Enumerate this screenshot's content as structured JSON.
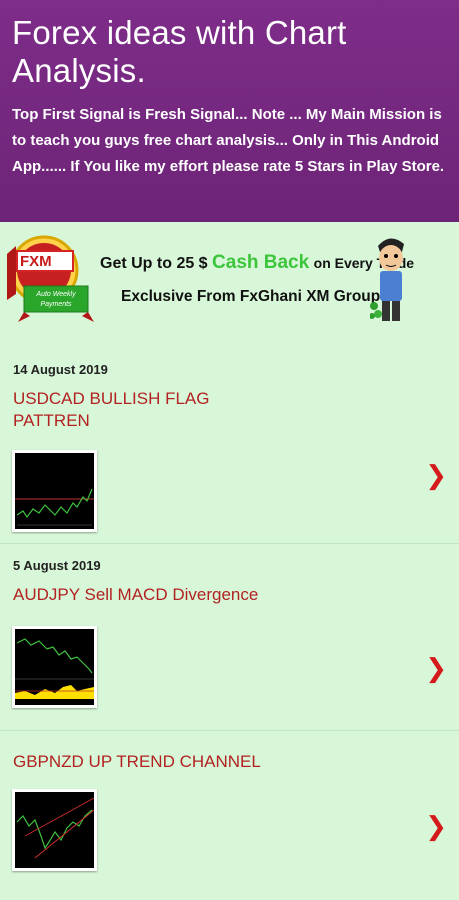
{
  "header": {
    "title": "Forex ideas with Chart Analysis.",
    "description": "Top First Signal is Fresh Signal... Note ... My Main Mission is to teach you guys free chart analysis... Only in This Android App...... If You like my effort please rate 5 Stars in Play Store."
  },
  "banner": {
    "badge_logo": "FXM",
    "badge_ribbon": "Auto Weekly Payments",
    "line1_prefix": "Get Up to 25 $",
    "line1_highlight": "Cash Back",
    "line1_suffix": "on Every Trade",
    "line2": "Exclusive From FxGhani XM Group"
  },
  "posts": [
    {
      "date": "14 August 2019",
      "title_line1": "USDCAD BULLISH FLAG",
      "title_line2": "PATTREN"
    },
    {
      "date": "5 August 2019",
      "title": "AUDJPY Sell MACD Divergence"
    },
    {
      "title": "GBPNZD UP TREND CHANNEL"
    }
  ],
  "icons": {
    "chevron": "chevron-right-icon"
  },
  "colors": {
    "header_bg": "#7b2b84",
    "body_bg": "#d8f7d8",
    "title_red": "#b22222",
    "chevron_red": "#d41a1a",
    "cash_back_green": "#3cc63c"
  }
}
